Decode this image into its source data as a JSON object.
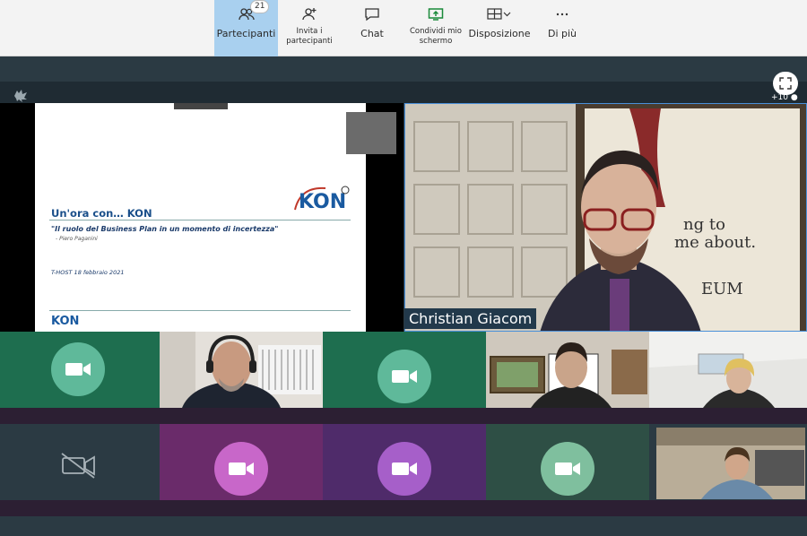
{
  "toolbar": {
    "participants": {
      "label": "Partecipanti",
      "count": "21"
    },
    "invite": {
      "label": "Invita i partecipanti"
    },
    "chat": {
      "label": "Chat"
    },
    "share": {
      "label": "Condividi mio schermo"
    },
    "layout": {
      "label": "Disposizione"
    },
    "more": {
      "label": "Di più"
    }
  },
  "overflow_count": "+10",
  "slide": {
    "title": "Un'ora con… KON",
    "subtitle": "\"Il ruolo del Business Plan in un momento di incertezza\"",
    "author": "- Piero Paganini",
    "date": "T-HOST 18 febbraio 2021",
    "logo_text": "KON"
  },
  "speaker": {
    "name": "Christian Giacom"
  },
  "colors": {
    "accent": "#a9d0ef",
    "green": "#1e6e4f",
    "teal": "#5fb99a",
    "purple": "#c867c9",
    "violet": "#a65fc9"
  }
}
